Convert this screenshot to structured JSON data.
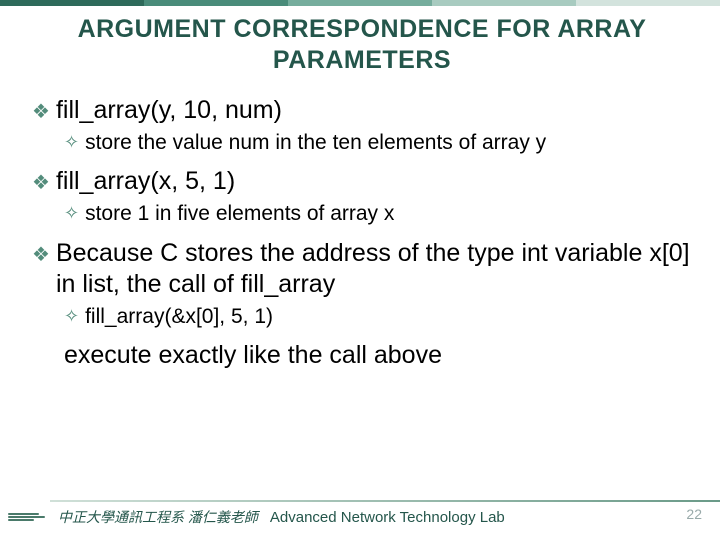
{
  "title": "ARGUMENT CORRESPONDENCE FOR ARRAY PARAMETERS",
  "bullets": [
    {
      "level": 1,
      "text": "fill_array(y, 10, num)"
    },
    {
      "level": 2,
      "text": "store the value num in the ten elements of array y"
    },
    {
      "level": 1,
      "text": "fill_array(x, 5, 1)"
    },
    {
      "level": 2,
      "text": "store 1 in five elements of array x"
    },
    {
      "level": 1,
      "text": "Because C stores the address of the type int variable x[0] in list, the call of fill_array"
    },
    {
      "level": 2,
      "text": "fill_array(&x[0], 5, 1)"
    }
  ],
  "continuation": "execute exactly like the call above",
  "footer": {
    "institution": "中正大學通訊工程系 潘仁義老師",
    "lab": "Advanced Network Technology Lab",
    "page": "22"
  },
  "markers": {
    "l1": "❖",
    "l2": "✧"
  }
}
